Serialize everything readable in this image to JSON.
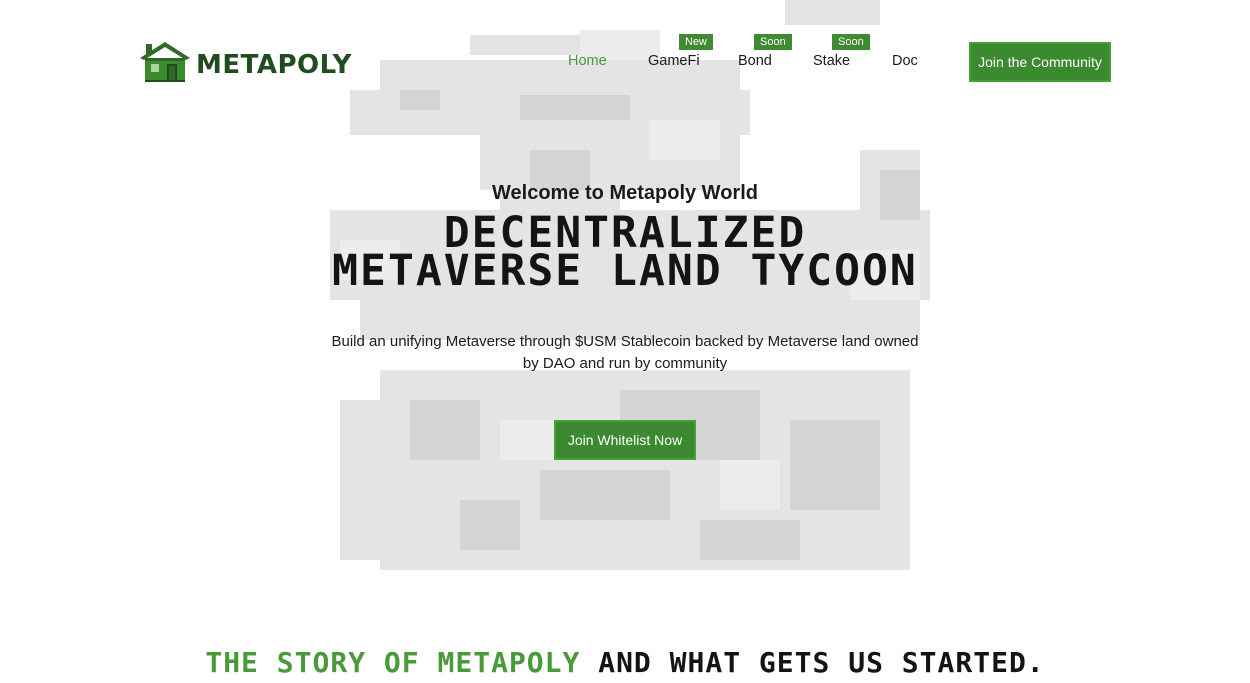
{
  "brand": {
    "name": "METAPOLY",
    "logo_icon": "house-icon",
    "primary_color": "#3c8a30",
    "dark_green": "#1f4d1f",
    "accent_green": "#4a9a3a"
  },
  "nav": {
    "items": [
      {
        "label": "Home",
        "active": true,
        "badge": ""
      },
      {
        "label": "GameFi",
        "active": false,
        "badge": "New"
      },
      {
        "label": "Bond",
        "active": false,
        "badge": "Soon"
      },
      {
        "label": "Stake",
        "active": false,
        "badge": "Soon"
      },
      {
        "label": "Doc",
        "active": false,
        "badge": ""
      }
    ],
    "cta_label": "Join the Community"
  },
  "hero": {
    "subtitle": "Welcome to Metapoly World",
    "title_line1": "DECENTRALIZED",
    "title_line2": "METAVERSE LAND TYCOON",
    "description": "Build an unifying Metaverse through $USM Stablecoin backed by Metaverse land owned by DAO and run by community",
    "cta_label": "Join Whitelist Now"
  },
  "story": {
    "title_green": "THE STORY OF METAPOLY",
    "title_dark": "AND WHAT GETS US STARTED."
  }
}
